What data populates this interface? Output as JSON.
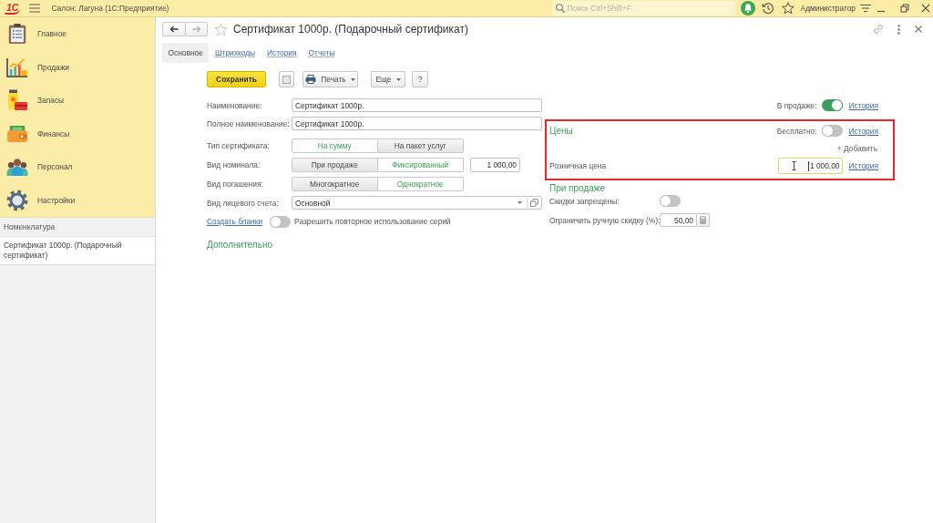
{
  "app_bar": {
    "logo": "1С",
    "title": "Салон: Лагуна (1С:Предприятие)",
    "search": {
      "placeholder": "Поиск Ctrl+Shift+F"
    },
    "user": "Администратор"
  },
  "sidebar": {
    "sections": [
      {
        "label": "Главное",
        "selected": false
      },
      {
        "label": "Продажи",
        "selected": false
      },
      {
        "label": "Запасы",
        "selected": false
      },
      {
        "label": "Финансы",
        "selected": false
      },
      {
        "label": "Персонал",
        "selected": false
      },
      {
        "label": "Настройки",
        "selected": false
      }
    ],
    "open_windows": {
      "title": "Номенклатура",
      "items": [
        {
          "label": "Сертификат 1000р. (Подарочный сертификат)",
          "selected": true
        }
      ]
    }
  },
  "form": {
    "navigation": {
      "back": {
        "disabled": false
      },
      "forward": {
        "disabled": true
      }
    },
    "favorite": false,
    "title": "Сертификат 1000р. (Подарочный сертификат)",
    "tabs": [
      {
        "label": "Основное",
        "selected": true
      },
      {
        "label": "Штрихкоды",
        "selected": false
      },
      {
        "label": "История",
        "selected": false
      },
      {
        "label": "Отчеты",
        "selected": false
      }
    ],
    "toolbar": [
      {
        "kind": "primary",
        "label": "Сохранить"
      },
      {
        "kind": "icon"
      },
      {
        "kind": "print",
        "label": "Печать"
      },
      {
        "kind": "menu",
        "label": "Еще"
      },
      {
        "kind": "plain",
        "label": "?"
      }
    ],
    "fields": [
      {
        "kind": "text",
        "label": "Наименование:",
        "value": "Сертификат 1000р."
      },
      {
        "kind": "text",
        "label": "Полное наименование:",
        "value": "Сертификат 1000р."
      },
      {
        "kind": "switch",
        "label": "Тип сертификата:",
        "options": [
          {
            "label": "На сумму",
            "selected": true
          },
          {
            "label": "На пакет услуг",
            "selected": false
          }
        ]
      },
      {
        "kind": "switch",
        "label": "Вид номинала:",
        "options": [
          {
            "label": "При продаже",
            "selected": false
          },
          {
            "label": "Фиксированный",
            "selected": true
          }
        ],
        "amount": "1 000,00"
      },
      {
        "kind": "switch",
        "label": "Вид погашения:",
        "options": [
          {
            "label": "Многократное",
            "selected": false
          },
          {
            "label": "Однократное",
            "selected": true
          }
        ]
      },
      {
        "kind": "select",
        "label": "Вид лицевого счета:",
        "value": "Основной"
      }
    ],
    "create_blanks": {
      "link": "Создать бланки",
      "reuse_series": {
        "label": "Разрешить повторное использование серий",
        "on": false
      }
    },
    "additional": {
      "title": "Дополнительно"
    },
    "on_sale": {
      "label": "В продаже:",
      "on": true,
      "link": "История"
    },
    "prices": {
      "highlighted": true,
      "title": "Цены",
      "free": {
        "label": "Бесплатно:",
        "on": false,
        "link": "История"
      },
      "add": "+ Добавить",
      "rows": [
        {
          "label": "Розничная цена",
          "value": "1 000,00",
          "focused": true,
          "link": "История"
        }
      ]
    },
    "at_sale": {
      "title": "При продаже",
      "no_discounts": {
        "label": "Скидки запрещены:",
        "on": false
      },
      "discount_limit": {
        "label": "Ограничить ручную скидку (%):",
        "value": "50,00"
      }
    }
  }
}
